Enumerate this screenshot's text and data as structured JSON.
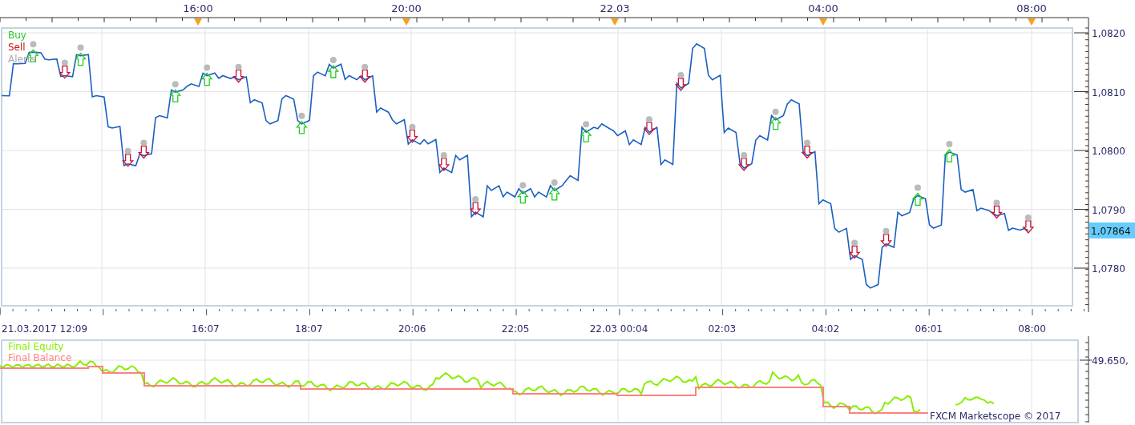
{
  "top_axis": {
    "labels": [
      "16:00",
      "20:00",
      "22.03",
      "04:00",
      "08:00"
    ]
  },
  "price_panel": {
    "legend": [
      {
        "label": "Buy",
        "color": "#22cc22"
      },
      {
        "label": "Sell",
        "color": "#cc1111"
      },
      {
        "label": "Alerts",
        "color": "#aaaaaa"
      }
    ],
    "current_price": "1,07864",
    "time_labels": [
      "21.03.2017 12:09",
      "16:07",
      "18:07",
      "20:06",
      "22:05",
      "22.03 00:04",
      "02:03",
      "04:02",
      "06:01",
      "08:00"
    ],
    "price_labels": [
      "1,0820",
      "1,0810",
      "1,0800",
      "1,0790",
      "1,0780"
    ]
  },
  "equity_panel": {
    "legend": [
      {
        "label": "Final Equity",
        "color": "#88ee00"
      },
      {
        "label": "Final Balance",
        "color": "#ff8080"
      }
    ],
    "axis_label": "49.650,",
    "credit": "FXCM Marketscope © 2017"
  }
}
